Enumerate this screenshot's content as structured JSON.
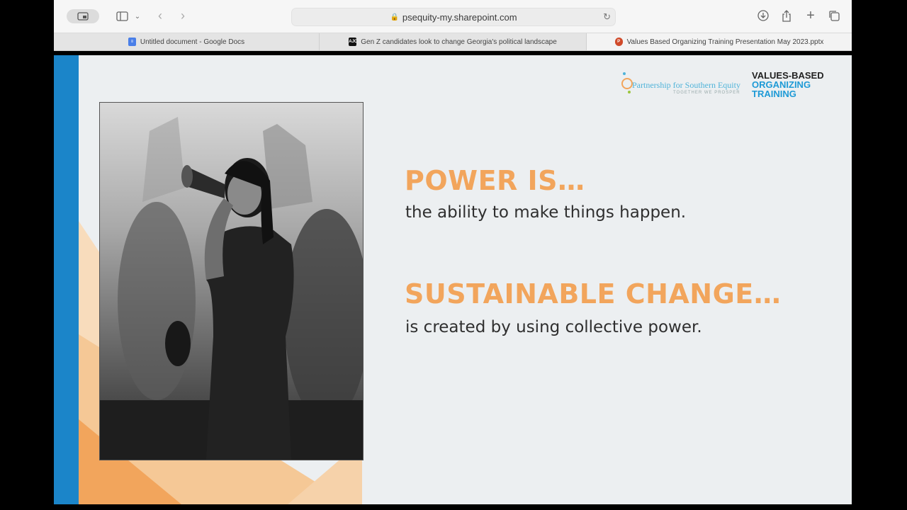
{
  "browser": {
    "url": "psequity-my.sharepoint.com",
    "tabs": [
      {
        "label": "Untitled document - Google Docs",
        "icon": "google-docs-icon",
        "color": "#4a7fe8"
      },
      {
        "label": "Gen Z candidates look to change Georgia's political landscape",
        "icon": "news-site-icon",
        "color": "#111111"
      },
      {
        "label": "Values Based Organizing Training Presentation May 2023.pptx",
        "icon": "powerpoint-icon",
        "color": "#d04a2a",
        "active": true
      }
    ]
  },
  "slide": {
    "logo_partner": {
      "name": "Partnership for Southern Equity",
      "tagline": "TOGETHER WE PROSPER"
    },
    "logo_program": {
      "line1": "VALUES-BASED",
      "line2": "ORGANIZING",
      "line3": "TRAINING"
    },
    "heading1": "POWER IS…",
    "text1": "the ability to make things happen.",
    "heading2": "SUSTAINABLE CHANGE…",
    "text2": "is created by using collective power.",
    "accent_color": "#f2a55c",
    "bar_color": "#1b85c9"
  }
}
